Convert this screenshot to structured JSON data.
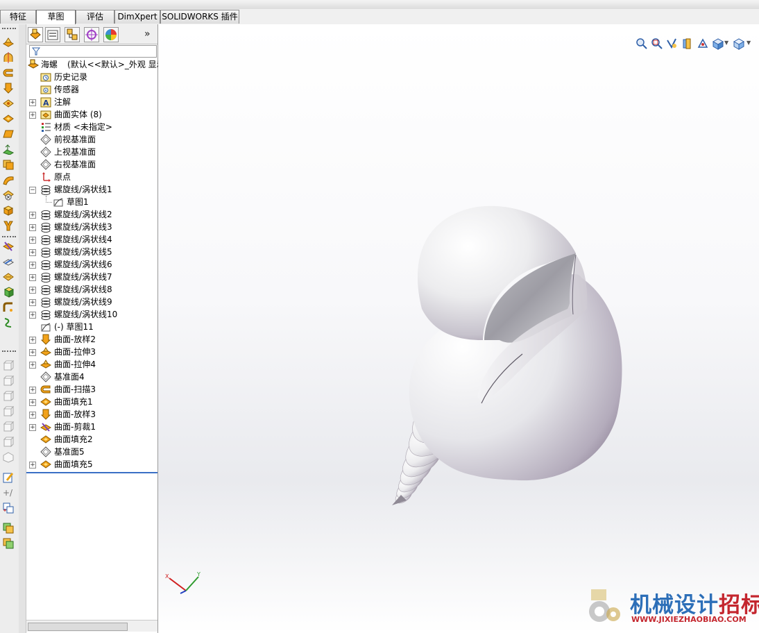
{
  "command_manager": {
    "tabs": [
      {
        "label": "特征"
      },
      {
        "label": "草图"
      },
      {
        "label": "评估"
      },
      {
        "label": "DimXpert"
      },
      {
        "label": "SOLIDWORKS 插件"
      }
    ],
    "active_tab": "草图"
  },
  "feature_manager": {
    "filter_icon": "funnel-icon",
    "root": {
      "name": "海螺",
      "config": "(默认<<默认>_外观 显示"
    },
    "items": [
      {
        "label": "历史记录",
        "icon": "history-folder-icon",
        "expand": ""
      },
      {
        "label": "传感器",
        "icon": "sensor-folder-icon",
        "expand": ""
      },
      {
        "label": "注解",
        "icon": "annotation-folder-icon",
        "expand": "+"
      },
      {
        "label": "曲面实体 (8)",
        "icon": "surface-bodies-folder-icon",
        "expand": "+"
      },
      {
        "label": "材质 <未指定>",
        "icon": "material-icon",
        "expand": ""
      },
      {
        "label": "前视基准面",
        "icon": "plane-icon",
        "expand": ""
      },
      {
        "label": "上视基准面",
        "icon": "plane-icon",
        "expand": ""
      },
      {
        "label": "右视基准面",
        "icon": "plane-icon",
        "expand": ""
      },
      {
        "label": "原点",
        "icon": "origin-icon",
        "expand": ""
      },
      {
        "label": "螺旋线/涡状线1",
        "icon": "helix-icon",
        "expand": "−"
      },
      {
        "label": "草图1",
        "icon": "sketch-icon",
        "expand": "",
        "child": true
      },
      {
        "label": "螺旋线/涡状线2",
        "icon": "helix-icon",
        "expand": "+"
      },
      {
        "label": "螺旋线/涡状线3",
        "icon": "helix-icon",
        "expand": "+"
      },
      {
        "label": "螺旋线/涡状线4",
        "icon": "helix-icon",
        "expand": "+"
      },
      {
        "label": "螺旋线/涡状线5",
        "icon": "helix-icon",
        "expand": "+"
      },
      {
        "label": "螺旋线/涡状线6",
        "icon": "helix-icon",
        "expand": "+"
      },
      {
        "label": "螺旋线/涡状线7",
        "icon": "helix-icon",
        "expand": "+"
      },
      {
        "label": "螺旋线/涡状线8",
        "icon": "helix-icon",
        "expand": "+"
      },
      {
        "label": "螺旋线/涡状线9",
        "icon": "helix-icon",
        "expand": "+"
      },
      {
        "label": "螺旋线/涡状线10",
        "icon": "helix-icon",
        "expand": "+"
      },
      {
        "label": "(-) 草图11",
        "icon": "sketch-icon",
        "expand": ""
      },
      {
        "label": "曲面-放样2",
        "icon": "surface-loft-icon",
        "expand": "+"
      },
      {
        "label": "曲面-拉伸3",
        "icon": "surface-extrude-icon",
        "expand": "+"
      },
      {
        "label": "曲面-拉伸4",
        "icon": "surface-extrude-icon",
        "expand": "+"
      },
      {
        "label": "基准面4",
        "icon": "plane-icon",
        "expand": ""
      },
      {
        "label": "曲面-扫描3",
        "icon": "surface-sweep-icon",
        "expand": "+"
      },
      {
        "label": "曲面填充1",
        "icon": "surface-fill-icon",
        "expand": "+"
      },
      {
        "label": "曲面-放样3",
        "icon": "surface-loft-icon",
        "expand": "+"
      },
      {
        "label": "曲面-剪裁1",
        "icon": "surface-trim-icon",
        "expand": "+"
      },
      {
        "label": "曲面填充2",
        "icon": "surface-fill-icon",
        "expand": ""
      },
      {
        "label": "基准面5",
        "icon": "plane-icon",
        "expand": ""
      },
      {
        "label": "曲面填充5",
        "icon": "surface-fill-icon",
        "expand": "+"
      }
    ]
  },
  "viewport": {
    "triad": {
      "x": "X",
      "y": "Y"
    },
    "view_tools": [
      "zoom-to-fit-icon",
      "zoom-area-icon",
      "previous-view-icon",
      "section-view-icon",
      "view-orientation-icon",
      "display-style-icon",
      "hide-show-icon"
    ]
  },
  "watermark": {
    "title": "机械设计招标网",
    "url": "WWW.JIXIEZHAOBIAO.COM"
  },
  "colors": {
    "accent": "#3a6fc5",
    "watermark_blue": "#2d6fb8",
    "watermark_red": "#c4262e",
    "shell_shadow": "#8a7d92"
  }
}
